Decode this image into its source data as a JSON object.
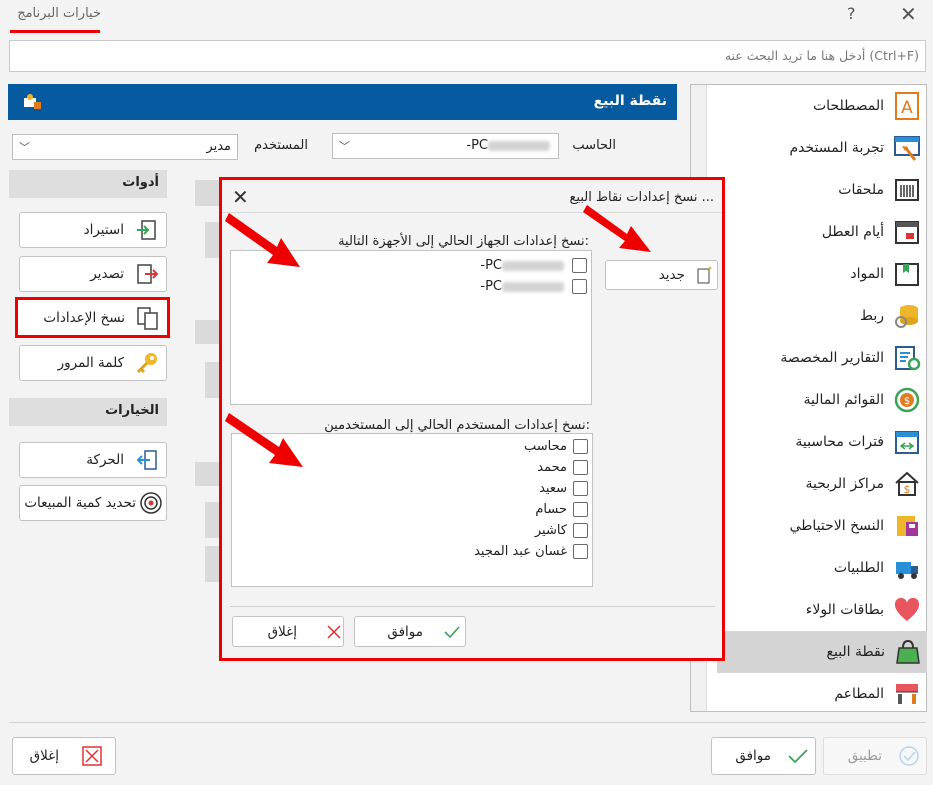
{
  "window": {
    "title": "خيارات البرنامج",
    "help": "?",
    "close": "✕"
  },
  "search": {
    "placeholder": "أدخل هنا ما تريد البحث عنه (Ctrl+F)"
  },
  "nav": [
    {
      "label": "المصطلحات",
      "icon": "letter-a-icon"
    },
    {
      "label": "تجربة المستخدم",
      "icon": "user-experience-icon"
    },
    {
      "label": "ملحقات",
      "icon": "barcode-icon"
    },
    {
      "label": "أيام العطل",
      "icon": "calendar-icon"
    },
    {
      "label": "المواد",
      "icon": "box-icon"
    },
    {
      "label": "ربط",
      "icon": "database-link-icon"
    },
    {
      "label": "التقارير المخصصة",
      "icon": "report-gear-icon"
    },
    {
      "label": "القوائم المالية",
      "icon": "money-cycle-icon"
    },
    {
      "label": "فترات محاسبية",
      "icon": "calendar-arrows-icon"
    },
    {
      "label": "مراكز الربحية",
      "icon": "profit-house-icon"
    },
    {
      "label": "النسخ الاحتياطي",
      "icon": "backup-icon"
    },
    {
      "label": "الطلبيات",
      "icon": "truck-icon"
    },
    {
      "label": "بطاقات الولاء",
      "icon": "heart-icon"
    },
    {
      "label": "نقطة البيع",
      "icon": "shopping-bag-icon"
    },
    {
      "label": "المطاعم",
      "icon": "restaurant-icon"
    }
  ],
  "header": {
    "title": "نقطة البيع"
  },
  "computer": {
    "label": "الحاسب",
    "value": "-PC"
  },
  "user": {
    "label": "المستخدم",
    "value": "مدير"
  },
  "tools": {
    "title": "أدوات",
    "import": "استيراد",
    "export": "تصدير",
    "copy_settings": "نسخ الإعدادات",
    "password": "كلمة المرور"
  },
  "options": {
    "title": "الخيارات",
    "movement": "الحركة",
    "sales_quantity": "تحديد كمية المبيعات"
  },
  "dialog": {
    "title": "نسخ إعدادات نقاط البيع ...",
    "close": "✕",
    "devices_label": "نسخ إعدادات الجهاز الحالي إلى الأجهزة التالية:",
    "devices": [
      "-PC",
      "-PC"
    ],
    "new_button": "جديد",
    "users_label": "نسخ إعدادات المستخدم الحالي إلى المستخدمين:",
    "users": [
      "محاسب",
      "محمد",
      "سعيد",
      "حسام",
      "كاشير",
      "غسان عبد المجيد"
    ],
    "ok": "موافق",
    "cancel": "إغلاق"
  },
  "footer": {
    "close": "إغلاق",
    "ok": "موافق",
    "apply": "تطبيق"
  },
  "colors": {
    "header_bg": "#055aa0",
    "highlight": "#e00000",
    "selected_nav": "#d4d4d4"
  }
}
